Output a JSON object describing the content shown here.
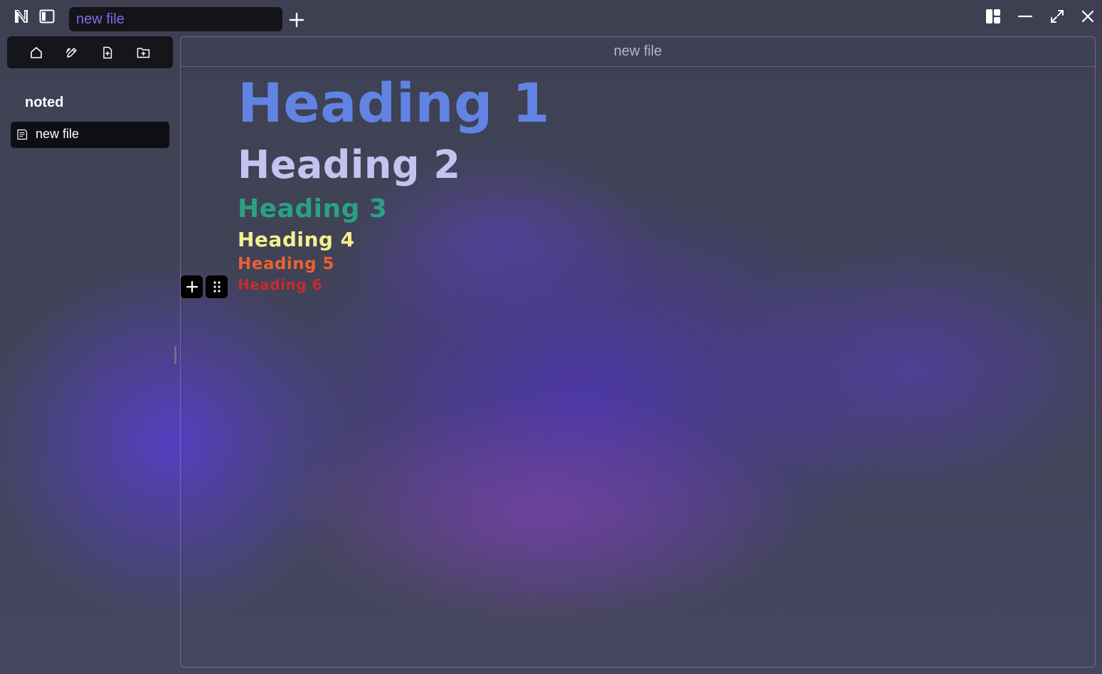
{
  "app": {
    "logo_icon": "noted-logo-icon",
    "colors": {
      "tab_text": "#7a6ee8",
      "accent_purple": "#5a42d0"
    }
  },
  "titlebar": {
    "tab_label": "new file",
    "icons": [
      "sidebar-toggle-icon",
      "plus-icon",
      "layout-icon",
      "minimize-icon",
      "maximize-icon",
      "close-icon"
    ]
  },
  "sidebar": {
    "toolbar_icons": [
      "home-icon",
      "edit-icon",
      "new-file-icon",
      "new-folder-icon"
    ],
    "workspace_title": "noted",
    "files": [
      {
        "label": "new file",
        "icon": "document-icon",
        "selected": true
      }
    ]
  },
  "editor": {
    "title": "new file",
    "headings": [
      {
        "text": "Heading 1",
        "color": "#6183e2"
      },
      {
        "text": "Heading 2",
        "color": "#c4c3f0"
      },
      {
        "text": "Heading 3",
        "color": "#2aa182"
      },
      {
        "text": "Heading 4",
        "color": "#f5ef8f"
      },
      {
        "text": "Heading 5",
        "color": "#ec6131"
      },
      {
        "text": "Heading 6",
        "color": "#c62c2c"
      }
    ],
    "block_controls": [
      "plus-icon",
      "drag-handle-icon"
    ]
  }
}
